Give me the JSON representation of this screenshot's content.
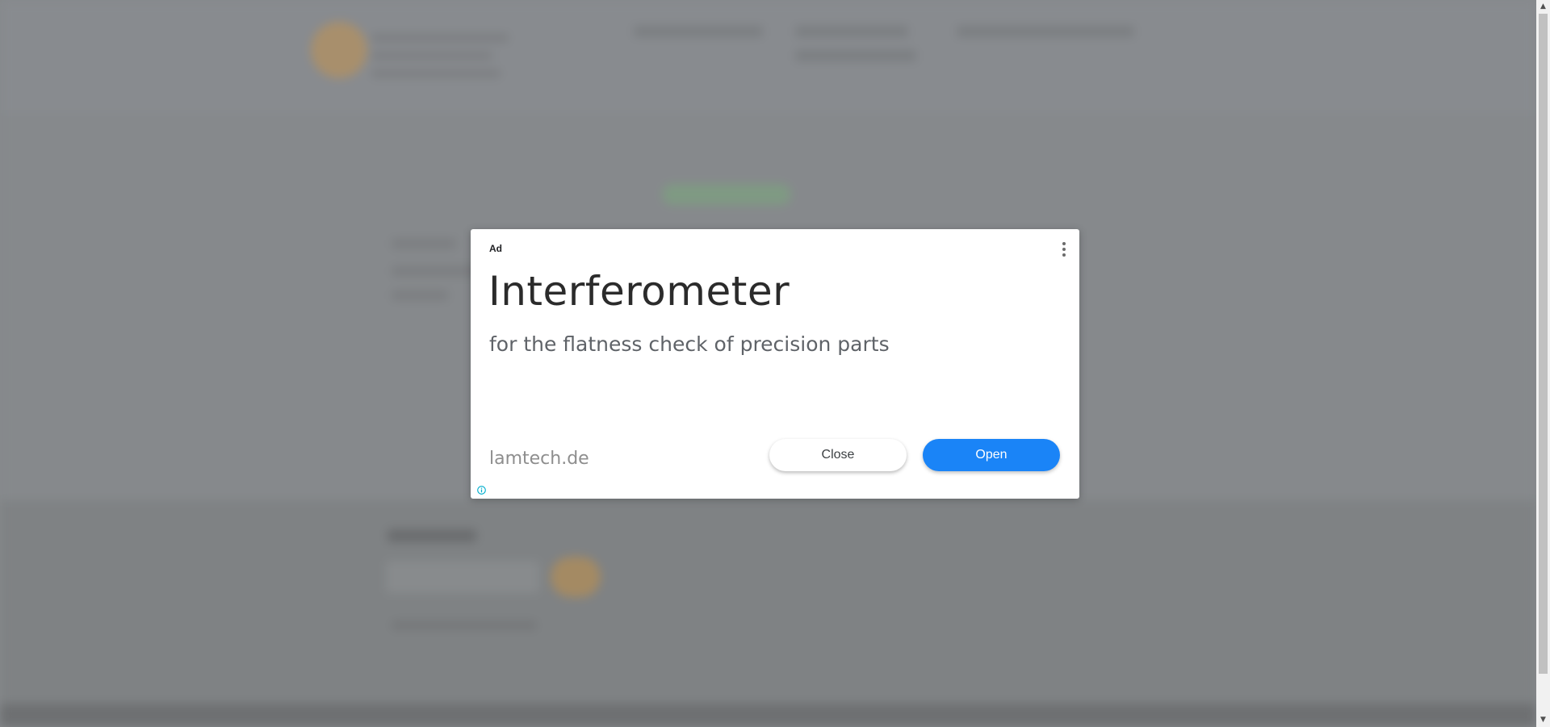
{
  "ad": {
    "label": "Ad",
    "title": "Interferometer",
    "subtitle": "for the flatness check of precision parts",
    "domain": "lamtech.de",
    "close_label": "Close",
    "open_label": "Open",
    "menu_icon": "more-vert-icon",
    "info_icon": "info-icon"
  },
  "colors": {
    "overlay": "#86898c",
    "open_button": "#1a84f7",
    "card": "#ffffff",
    "info_icon": "#00aecd"
  }
}
